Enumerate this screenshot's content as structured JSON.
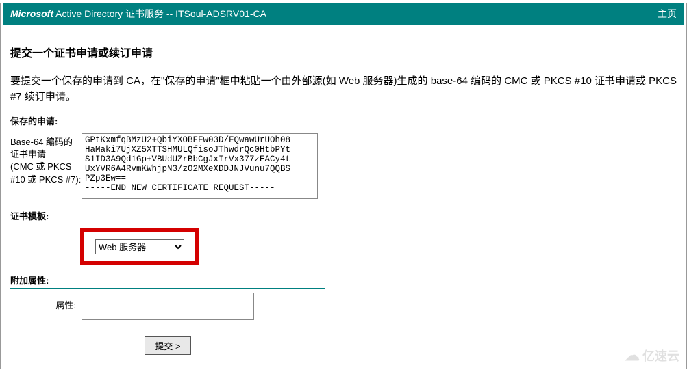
{
  "header": {
    "brand": "Microsoft",
    "product": " Active Directory 证书服务",
    "separator": "  --  ",
    "ca_name": "ITSoul-ADSRV01-CA",
    "home_link": "主页"
  },
  "page": {
    "title": "提交一个证书申请或续订申请",
    "description": "要提交一个保存的申请到 CA，在\"保存的申请\"框中粘贴一个由外部源(如 Web 服务器)生成的 base-64 编码的 CMC 或 PKCS #10 证书申请或 PKCS #7 续订申请。"
  },
  "sections": {
    "saved_request": {
      "heading": "保存的申请:",
      "label": "Base-64 编码的证书申请\n(CMC 或 PKCS #10 或 PKCS #7):",
      "value": "GPtKxmfqBMzU2+QbiYXOBFFw03D/FQwawUrUOh08\nHaMaki7UjXZ5XTTSHMULQfisoJThwdrQc0HtbPYt\nS1ID3A9Qd1Gp+VBUdUZrBbCgJxIrVx377zEACy4t\nUxYVR6A4RvmKWhjpN3/zO2MXeXDDJNJVunu7QQBS\nPZp3Ew==\n-----END NEW CERTIFICATE REQUEST-----"
    },
    "template": {
      "heading": "证书模板:",
      "selected": "Web 服务器"
    },
    "additional_attrs": {
      "heading": "附加属性:",
      "label": "属性:",
      "value": ""
    }
  },
  "buttons": {
    "submit": "提交 >"
  },
  "watermark": {
    "text": "亿速云"
  }
}
